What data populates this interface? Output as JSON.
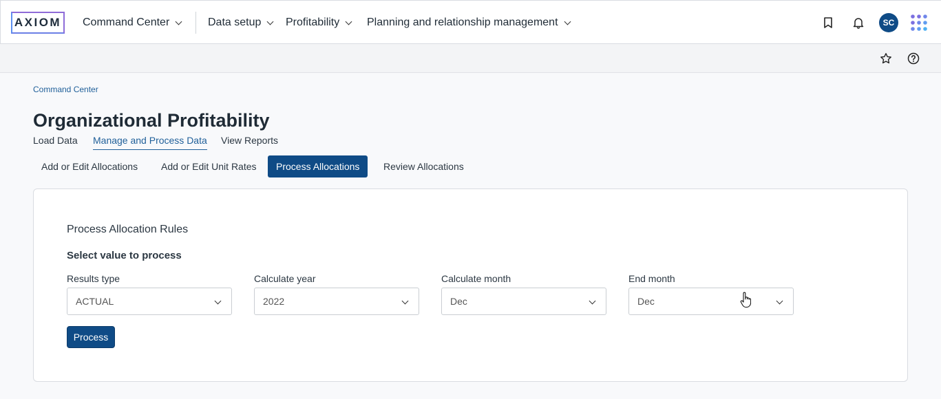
{
  "header": {
    "logo_text": "AXIOM",
    "nav": [
      {
        "label": "Command Center"
      },
      {
        "label": "Data setup"
      },
      {
        "label": "Profitability"
      },
      {
        "label": "Planning and relationship management"
      }
    ],
    "avatar_initials": "SC",
    "icons": [
      "bookmark-icon",
      "bell-icon",
      "apps-grid-icon",
      "star-icon",
      "help-icon"
    ]
  },
  "breadcrumb": "Command Center",
  "page_title": "Organizational Profitability",
  "tabs": [
    {
      "label": "Load Data",
      "active": false
    },
    {
      "label": "Manage and Process Data",
      "active": true
    },
    {
      "label": "View Reports",
      "active": false
    }
  ],
  "subtabs": [
    {
      "label": "Add or Edit Allocations",
      "active": false
    },
    {
      "label": "Add or Edit Unit Rates",
      "active": false
    },
    {
      "label": "Process Allocations",
      "active": true
    },
    {
      "label": "Review Allocations",
      "active": false
    }
  ],
  "card": {
    "title": "Process Allocation Rules",
    "subtitle": "Select value to process",
    "fields": [
      {
        "label": "Results type",
        "value": "ACTUAL"
      },
      {
        "label": "Calculate year",
        "value": "2022"
      },
      {
        "label": "Calculate month",
        "value": "Dec"
      },
      {
        "label": "End month",
        "value": "Dec"
      }
    ],
    "process_label": "Process"
  },
  "colors": {
    "primary": "#0f4b86",
    "link": "#1f5f99",
    "logo_accent": "#8e6bd8"
  }
}
